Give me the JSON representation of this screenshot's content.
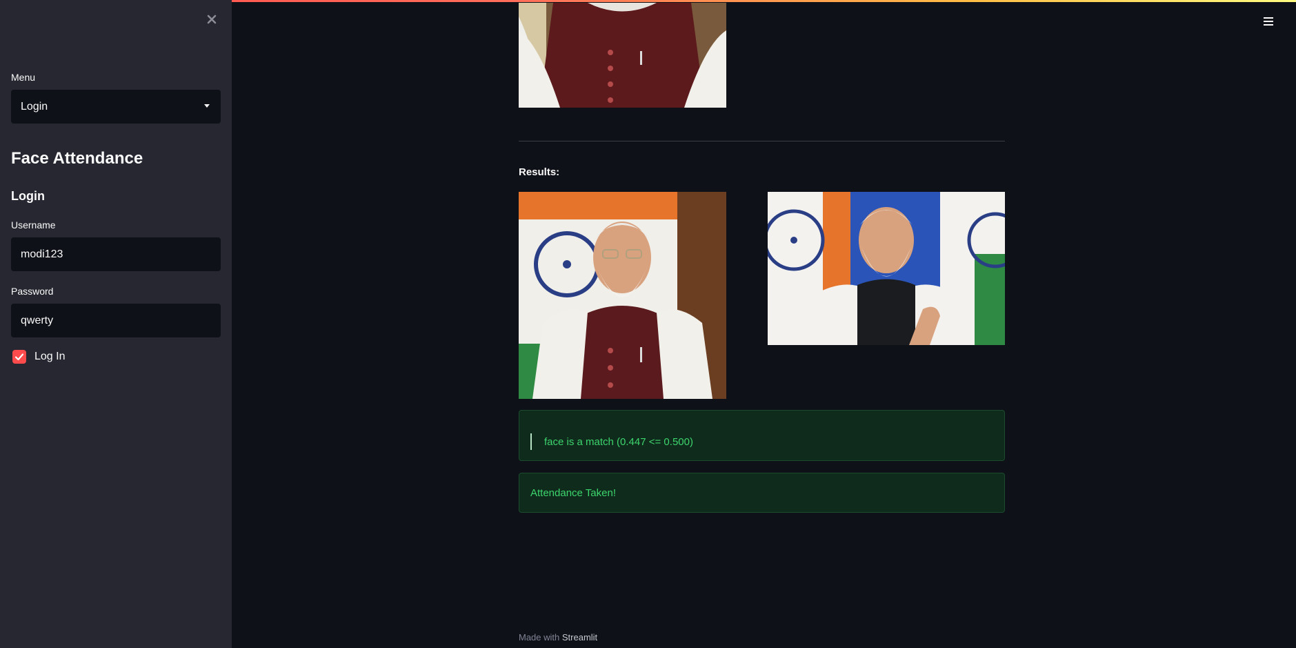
{
  "sidebar": {
    "close_icon": "close-icon",
    "menu_label": "Menu",
    "menu_selected": "Login",
    "app_title": "Face Attendance",
    "section_title": "Login",
    "username_label": "Username",
    "username_value": "modi123",
    "password_label": "Password",
    "password_value": "qwerty",
    "login_checkbox_label": "Log In",
    "login_checkbox_checked": true
  },
  "header": {
    "menu_icon": "hamburger-menu-icon"
  },
  "main": {
    "results_label": "Results:",
    "match_message": "face is a match (0.447 <= 0.500)",
    "success_message": "Attendance Taken!"
  },
  "footer": {
    "made_with": "Made with",
    "brand": "Streamlit"
  },
  "colors": {
    "background": "#0e1117",
    "sidebar": "#262730",
    "accent": "#ff4b4b",
    "success_text": "#3dd56d",
    "success_bg": "#0f2b1c"
  }
}
